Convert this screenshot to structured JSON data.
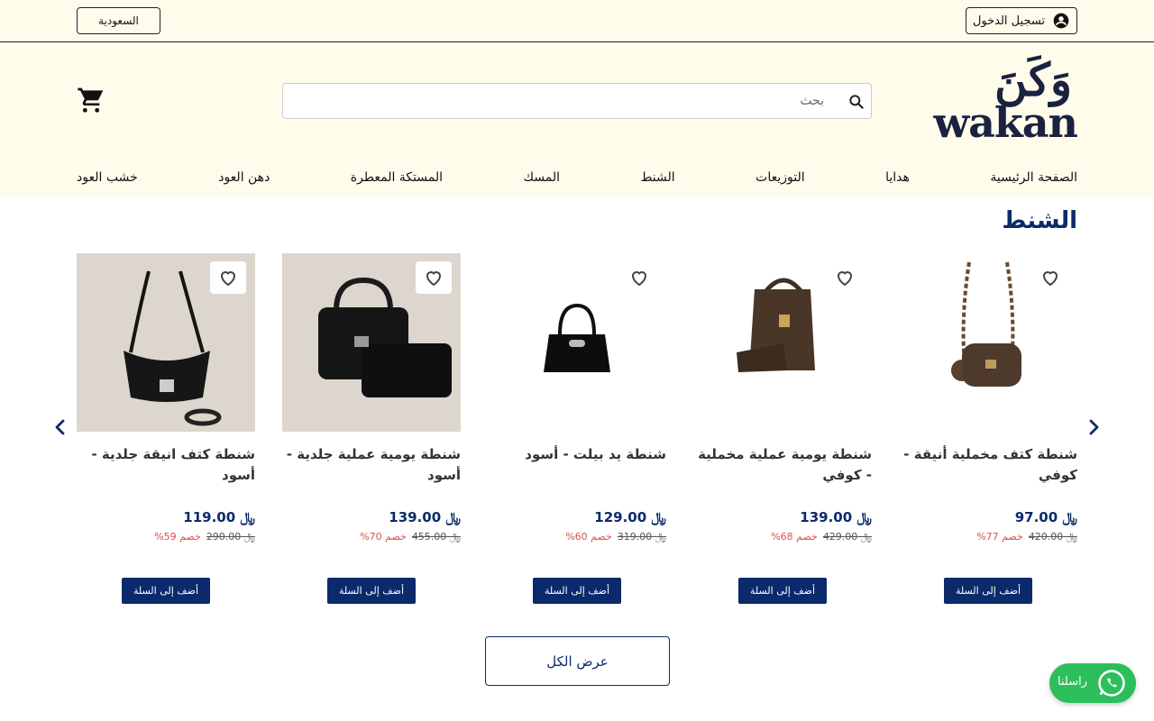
{
  "topbar": {
    "login_label": "تسجيل الدخول",
    "country_label": "السعودية"
  },
  "header": {
    "logo_ar": "وَكَنَ",
    "logo_en": "wakan",
    "search_placeholder": "بحث"
  },
  "nav": {
    "items": [
      {
        "label": "الصفحة الرئيسية"
      },
      {
        "label": "هدايا"
      },
      {
        "label": "التوزيعات"
      },
      {
        "label": "الشنط"
      },
      {
        "label": "المسك"
      },
      {
        "label": "المستكة المعطرة"
      },
      {
        "label": "دهن العود"
      },
      {
        "label": "خشب العود"
      }
    ]
  },
  "section": {
    "title": "الشنط",
    "view_all": "عرض الكل"
  },
  "products": [
    {
      "name": "شنطة كتف مخملية أنيقة - كوفي",
      "price": "97.00",
      "old_price": "420.00",
      "discount": "خصم 77%",
      "add_label": "أضف إلى السلة"
    },
    {
      "name": "شنطة يومية عملية مخملية - كوفي",
      "price": "139.00",
      "old_price": "429.00",
      "discount": "خصم 68%",
      "add_label": "أضف إلى السلة"
    },
    {
      "name": "شنطة يد بيلت - أسود",
      "price": "129.00",
      "old_price": "319.00",
      "discount": "خصم 60%",
      "add_label": "أضف إلى السلة"
    },
    {
      "name": "شنطة يومية عملية جلدية - أسود",
      "price": "139.00",
      "old_price": "455.00",
      "discount": "خصم 70%",
      "add_label": "أضف إلى السلة"
    },
    {
      "name": "شنطة كتف انيقة جلدية - أسود",
      "price": "119.00",
      "old_price": "290.00",
      "discount": "خصم 59%",
      "add_label": "أضف إلى السلة"
    }
  ],
  "whatsapp": {
    "label": "راسلنا"
  },
  "colors": {
    "brand_navy": "#0b2a6b",
    "header_bg": "#fffcec",
    "discount_red": "#d9534f",
    "whatsapp_green": "#2dbe5c"
  }
}
